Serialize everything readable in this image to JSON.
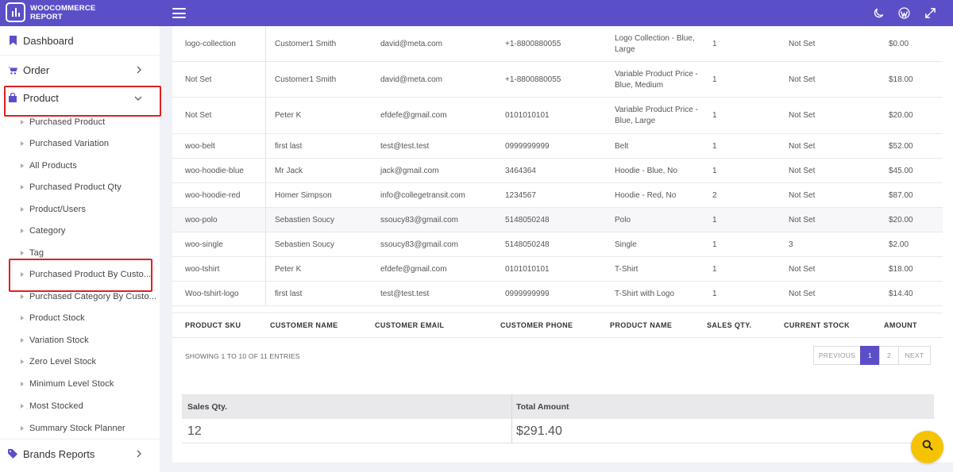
{
  "brand": {
    "line1": "WOOCOMMERCE",
    "line2": "REPORT"
  },
  "topbar_icons": [
    "moon-icon",
    "wordpress-icon",
    "fullscreen-icon"
  ],
  "colors": {
    "accent": "#5b4fc7",
    "highlight": "#e02020",
    "fab": "#f6c300"
  },
  "sidebar": {
    "dashboard": "Dashboard",
    "order": "Order",
    "product": "Product",
    "brands": "Brands Reports",
    "product_sub": [
      "Purchased Product",
      "Purchased Variation",
      "All Products",
      "Purchased Product Qty",
      "Product/Users",
      "Category",
      "Tag",
      "Purchased Product By Custo...",
      "Purchased Category By Custo...",
      "Product Stock",
      "Variation Stock",
      "Zero Level Stock",
      "Minimum Level Stock",
      "Most Stocked",
      "Summary Stock Planner"
    ]
  },
  "table": {
    "headers": [
      "PRODUCT SKU",
      "CUSTOMER NAME",
      "CUSTOMER EMAIL",
      "CUSTOMER PHONE",
      "PRODUCT NAME",
      "SALES QTY.",
      "CURRENT STOCK",
      "AMOUNT"
    ],
    "rows": [
      {
        "sku": "logo-collection",
        "name": "Customer1 Smith",
        "email": "david@meta.com",
        "phone": "+1-8800880055",
        "product": "Logo Collection - Blue, Large",
        "qty": "1",
        "stock": "Not Set",
        "amount": "$0.00"
      },
      {
        "sku": "Not Set",
        "name": "Customer1 Smith",
        "email": "david@meta.com",
        "phone": "+1-8800880055",
        "product": "Variable Product Price - Blue, Medium",
        "qty": "1",
        "stock": "Not Set",
        "amount": "$18.00"
      },
      {
        "sku": "Not Set",
        "name": "Peter K",
        "email": "efdefe@gmail.com",
        "phone": "0101010101",
        "product": "Variable Product Price - Blue, Large",
        "qty": "1",
        "stock": "Not Set",
        "amount": "$20.00"
      },
      {
        "sku": "woo-belt",
        "name": "first last",
        "email": "test@test.test",
        "phone": "0999999999",
        "product": "Belt",
        "qty": "1",
        "stock": "Not Set",
        "amount": "$52.00"
      },
      {
        "sku": "woo-hoodie-blue",
        "name": "Mr Jack",
        "email": "jack@gmail.com",
        "phone": "3464364",
        "product": "Hoodie - Blue, No",
        "qty": "1",
        "stock": "Not Set",
        "amount": "$45.00"
      },
      {
        "sku": "woo-hoodie-red",
        "name": "Homer Simpson",
        "email": "info@collegetransit.com",
        "phone": "1234567",
        "product": "Hoodie - Red, No",
        "qty": "2",
        "stock": "Not Set",
        "amount": "$87.00"
      },
      {
        "sku": "woo-polo",
        "name": "Sebastien Soucy",
        "email": "ssoucy83@gmail.com",
        "phone": "5148050248",
        "product": "Polo",
        "qty": "1",
        "stock": "Not Set",
        "amount": "$20.00"
      },
      {
        "sku": "woo-single",
        "name": "Sebastien Soucy",
        "email": "ssoucy83@gmail.com",
        "phone": "5148050248",
        "product": "Single",
        "qty": "1",
        "stock": "3",
        "amount": "$2.00"
      },
      {
        "sku": "woo-tshirt",
        "name": "Peter K",
        "email": "efdefe@gmail.com",
        "phone": "0101010101",
        "product": "T-Shirt",
        "qty": "1",
        "stock": "Not Set",
        "amount": "$18.00"
      },
      {
        "sku": "Woo-tshirt-logo",
        "name": "first last",
        "email": "test@test.test",
        "phone": "0999999999",
        "product": "T-Shirt with Logo",
        "qty": "1",
        "stock": "Not Set",
        "amount": "$14.40"
      }
    ],
    "showing": "SHOWING 1 TO 10 OF 11 ENTRIES",
    "pager": {
      "previous": "PREVIOUS",
      "page1": "1",
      "page2": "2",
      "next": "NEXT"
    }
  },
  "summary": {
    "qty_label": "Sales Qty.",
    "amount_label": "Total Amount",
    "qty_value": "12",
    "amount_value": "$291.40"
  }
}
